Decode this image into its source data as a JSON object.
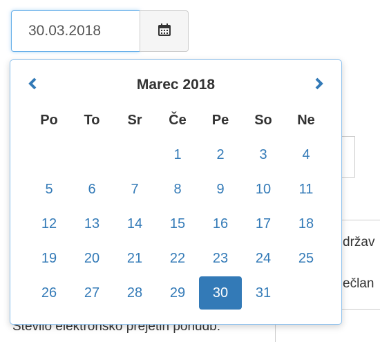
{
  "date_field": {
    "value": "30.03.2018",
    "icon": "calendar-icon"
  },
  "background": {
    "partial_text_1": "držav",
    "partial_text_2": "ečlan",
    "bottom_text": "Število elektronsko prejetih ponudb:"
  },
  "datepicker": {
    "month_label": "Marec 2018",
    "prev_icon": "chevron-left-icon",
    "next_icon": "chevron-right-icon",
    "weekdays": [
      "Po",
      "To",
      "Sr",
      "Če",
      "Pe",
      "So",
      "Ne"
    ],
    "weeks": [
      [
        "",
        "",
        "",
        "1",
        "2",
        "3",
        "4"
      ],
      [
        "5",
        "6",
        "7",
        "8",
        "9",
        "10",
        "11"
      ],
      [
        "12",
        "13",
        "14",
        "15",
        "16",
        "17",
        "18"
      ],
      [
        "19",
        "20",
        "21",
        "22",
        "23",
        "24",
        "25"
      ],
      [
        "26",
        "27",
        "28",
        "29",
        "30",
        "31",
        ""
      ]
    ],
    "selected_day": "30",
    "accent_color": "#337ab7"
  }
}
